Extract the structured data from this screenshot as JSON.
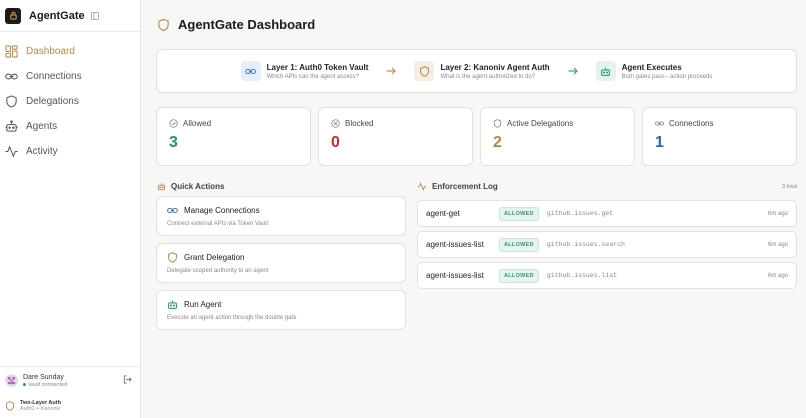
{
  "brand": {
    "name": "AgentGate"
  },
  "sidebar": {
    "items": [
      {
        "label": "Dashboard",
        "icon": "dashboard-icon",
        "active": true
      },
      {
        "label": "Connections",
        "icon": "link-icon"
      },
      {
        "label": "Delegations",
        "icon": "shield-icon"
      },
      {
        "label": "Agents",
        "icon": "bot-icon"
      },
      {
        "label": "Activity",
        "icon": "activity-icon"
      }
    ],
    "user": {
      "name": "Dare Sunday",
      "status": "Vault connected"
    },
    "footer": {
      "title": "Two-Layer Auth",
      "subtitle": "Auth0 + Kanoniv"
    }
  },
  "page": {
    "title": "AgentGate Dashboard"
  },
  "flow": {
    "steps": [
      {
        "title": "Layer 1: Auth0 Token Vault",
        "subtitle": "Which APIs can the agent access?",
        "icon": "link-icon",
        "color": "#4a78c2"
      },
      {
        "title": "Layer 2: Kanoniv Agent Auth",
        "subtitle": "What is the agent authorized to do?",
        "icon": "shield-icon",
        "color": "#b8894a"
      },
      {
        "title": "Agent Executes",
        "subtitle": "Both gates pass - action proceeds",
        "icon": "bot-icon",
        "color": "#2c9a6a"
      }
    ]
  },
  "stats": [
    {
      "label": "Allowed",
      "value": "3",
      "color": "#1f9a5c",
      "icon": "check-circle-icon"
    },
    {
      "label": "Blocked",
      "value": "0",
      "color": "#c42b2b",
      "icon": "x-circle-icon"
    },
    {
      "label": "Active Delegations",
      "value": "2",
      "color": "#b0893f",
      "icon": "shield-icon"
    },
    {
      "label": "Connections",
      "value": "1",
      "color": "#2a64c2",
      "icon": "link-icon"
    }
  ],
  "quick_actions": {
    "title": "Quick Actions",
    "items": [
      {
        "title": "Manage Connections",
        "desc": "Connect external APIs via Token Vault",
        "icon": "link-icon"
      },
      {
        "title": "Grant Delegation",
        "desc": "Delegate scoped authority to an agent",
        "icon": "shield-icon"
      },
      {
        "title": "Run Agent",
        "desc": "Execute an agent action through the double gate",
        "icon": "bot-icon"
      }
    ]
  },
  "log": {
    "title": "Enforcement Log",
    "total": "3 total",
    "rows": [
      {
        "agent": "agent-get",
        "status": "ALLOWED",
        "action": "github.issues.get",
        "time": "6m ago"
      },
      {
        "agent": "agent-issues-list",
        "status": "ALLOWED",
        "action": "github.issues.search",
        "time": "6m ago"
      },
      {
        "agent": "agent-issues-list",
        "status": "ALLOWED",
        "action": "github.issues.list",
        "time": "6m ago"
      }
    ]
  },
  "colors": {
    "accent": "#b8894a",
    "success": "#2c9a6a",
    "danger": "#c42b2b",
    "info": "#2a64c2"
  }
}
